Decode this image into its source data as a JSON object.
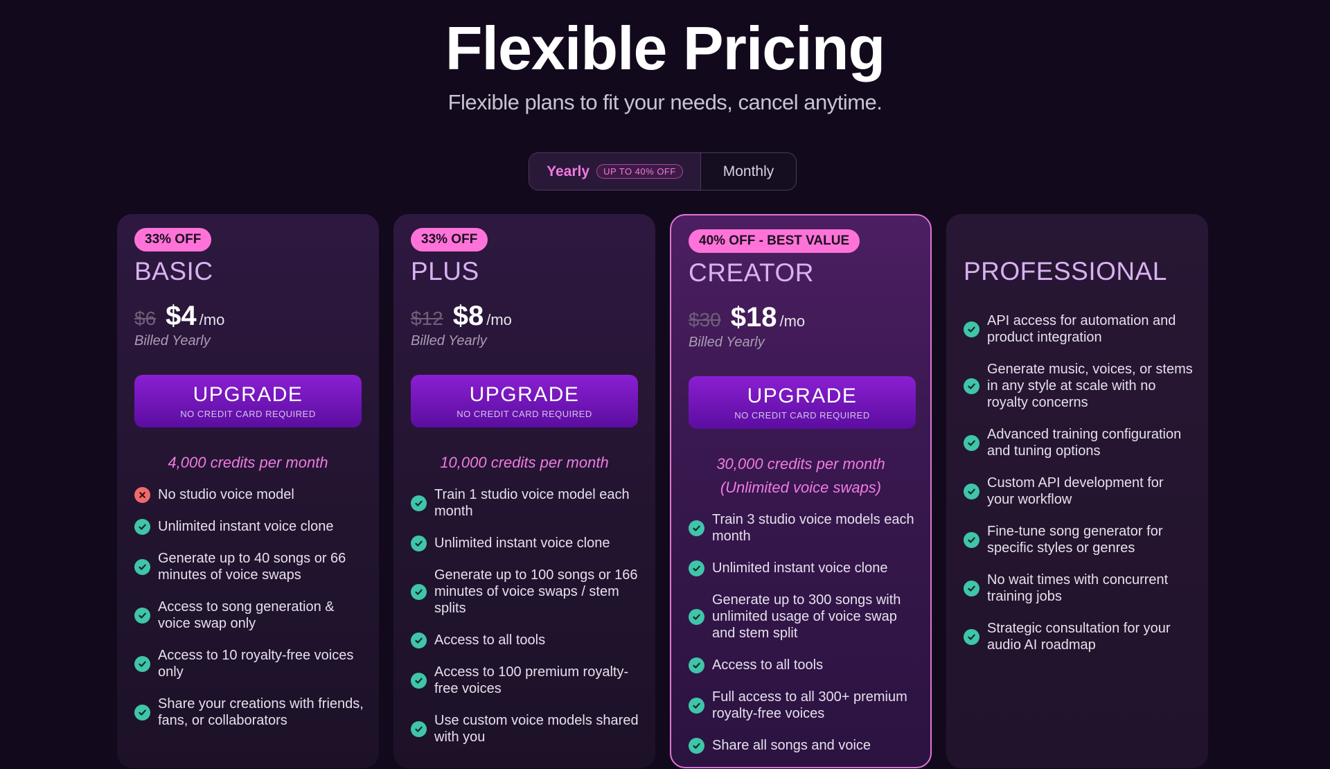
{
  "header": {
    "title": "Flexible Pricing",
    "subtitle": "Flexible plans to fit your needs, cancel anytime."
  },
  "billing_toggle": {
    "yearly_label": "Yearly",
    "yearly_badge": "UP TO 40% OFF",
    "monthly_label": "Monthly",
    "selected": "Yearly"
  },
  "colors": {
    "background": "#120a1c",
    "accent_pink": "#f07be0",
    "badge_pink": "#ff73d8",
    "button_purple": "#7a1ac4",
    "check_green": "#40c4aa",
    "cross_red": "#ef6b6b",
    "featured_border": "#e076d6"
  },
  "plans": [
    {
      "badge": "33% OFF",
      "name": "BASIC",
      "old_price": "$6",
      "price": "$4",
      "unit": "/mo",
      "billing": "Billed Yearly",
      "button_label": "UPGRADE",
      "button_sub": "NO CREDIT CARD REQUIRED",
      "credits": "4,000 credits per month",
      "features": [
        {
          "icon": "cross-icon",
          "text": "No studio voice model"
        },
        {
          "icon": "check-icon",
          "text": "Unlimited instant voice clone"
        },
        {
          "icon": "check-icon",
          "text": "Generate up to 40 songs or 66 minutes of voice swaps"
        },
        {
          "icon": "check-icon",
          "text": "Access to song generation & voice swap only"
        },
        {
          "icon": "check-icon",
          "text": "Access to 10 royalty-free voices only"
        },
        {
          "icon": "check-icon",
          "text": "Share your creations with friends, fans, or collaborators"
        }
      ]
    },
    {
      "badge": "33% OFF",
      "name": "PLUS",
      "old_price": "$12",
      "price": "$8",
      "unit": "/mo",
      "billing": "Billed Yearly",
      "button_label": "UPGRADE",
      "button_sub": "NO CREDIT CARD REQUIRED",
      "credits": "10,000 credits per month",
      "features": [
        {
          "icon": "check-icon",
          "text": "Train 1 studio voice model each month"
        },
        {
          "icon": "check-icon",
          "text": "Unlimited instant voice clone"
        },
        {
          "icon": "check-icon",
          "text": "Generate up to 100 songs or 166 minutes of voice swaps / stem splits"
        },
        {
          "icon": "check-icon",
          "text": "Access to all tools"
        },
        {
          "icon": "check-icon",
          "text": "Access to 100 premium royalty-free voices"
        },
        {
          "icon": "check-icon",
          "text": "Use custom voice models shared with you"
        }
      ]
    },
    {
      "badge": "40% OFF - BEST VALUE",
      "name": "CREATOR",
      "old_price": "$30",
      "price": "$18",
      "unit": "/mo",
      "billing": "Billed Yearly",
      "button_label": "UPGRADE",
      "button_sub": "NO CREDIT CARD REQUIRED",
      "credits": "30,000 credits per month",
      "credits_extra": "(Unlimited voice swaps)",
      "features": [
        {
          "icon": "check-icon",
          "text": "Train 3 studio voice models each month"
        },
        {
          "icon": "check-icon",
          "text": "Unlimited instant voice clone"
        },
        {
          "icon": "check-icon",
          "text": "Generate up to 300 songs with unlimited usage of voice swap and stem split"
        },
        {
          "icon": "check-icon",
          "text": "Access to all tools"
        },
        {
          "icon": "check-icon",
          "text": "Full access to all 300+ premium royalty-free voices"
        },
        {
          "icon": "check-icon",
          "text": "Share all songs and voice"
        }
      ]
    },
    {
      "name": "PROFESSIONAL",
      "features": [
        {
          "icon": "check-icon",
          "text": "API access for automation and product integration"
        },
        {
          "icon": "check-icon",
          "text": "Generate music, voices, or stems in any style at scale with no royalty concerns"
        },
        {
          "icon": "check-icon",
          "text": "Advanced training configuration and tuning options"
        },
        {
          "icon": "check-icon",
          "text": "Custom API development for your workflow"
        },
        {
          "icon": "check-icon",
          "text": "Fine-tune song generator for specific styles or genres"
        },
        {
          "icon": "check-icon",
          "text": "No wait times with concurrent training jobs"
        },
        {
          "icon": "check-icon",
          "text": "Strategic consultation for your audio AI roadmap"
        }
      ]
    }
  ]
}
